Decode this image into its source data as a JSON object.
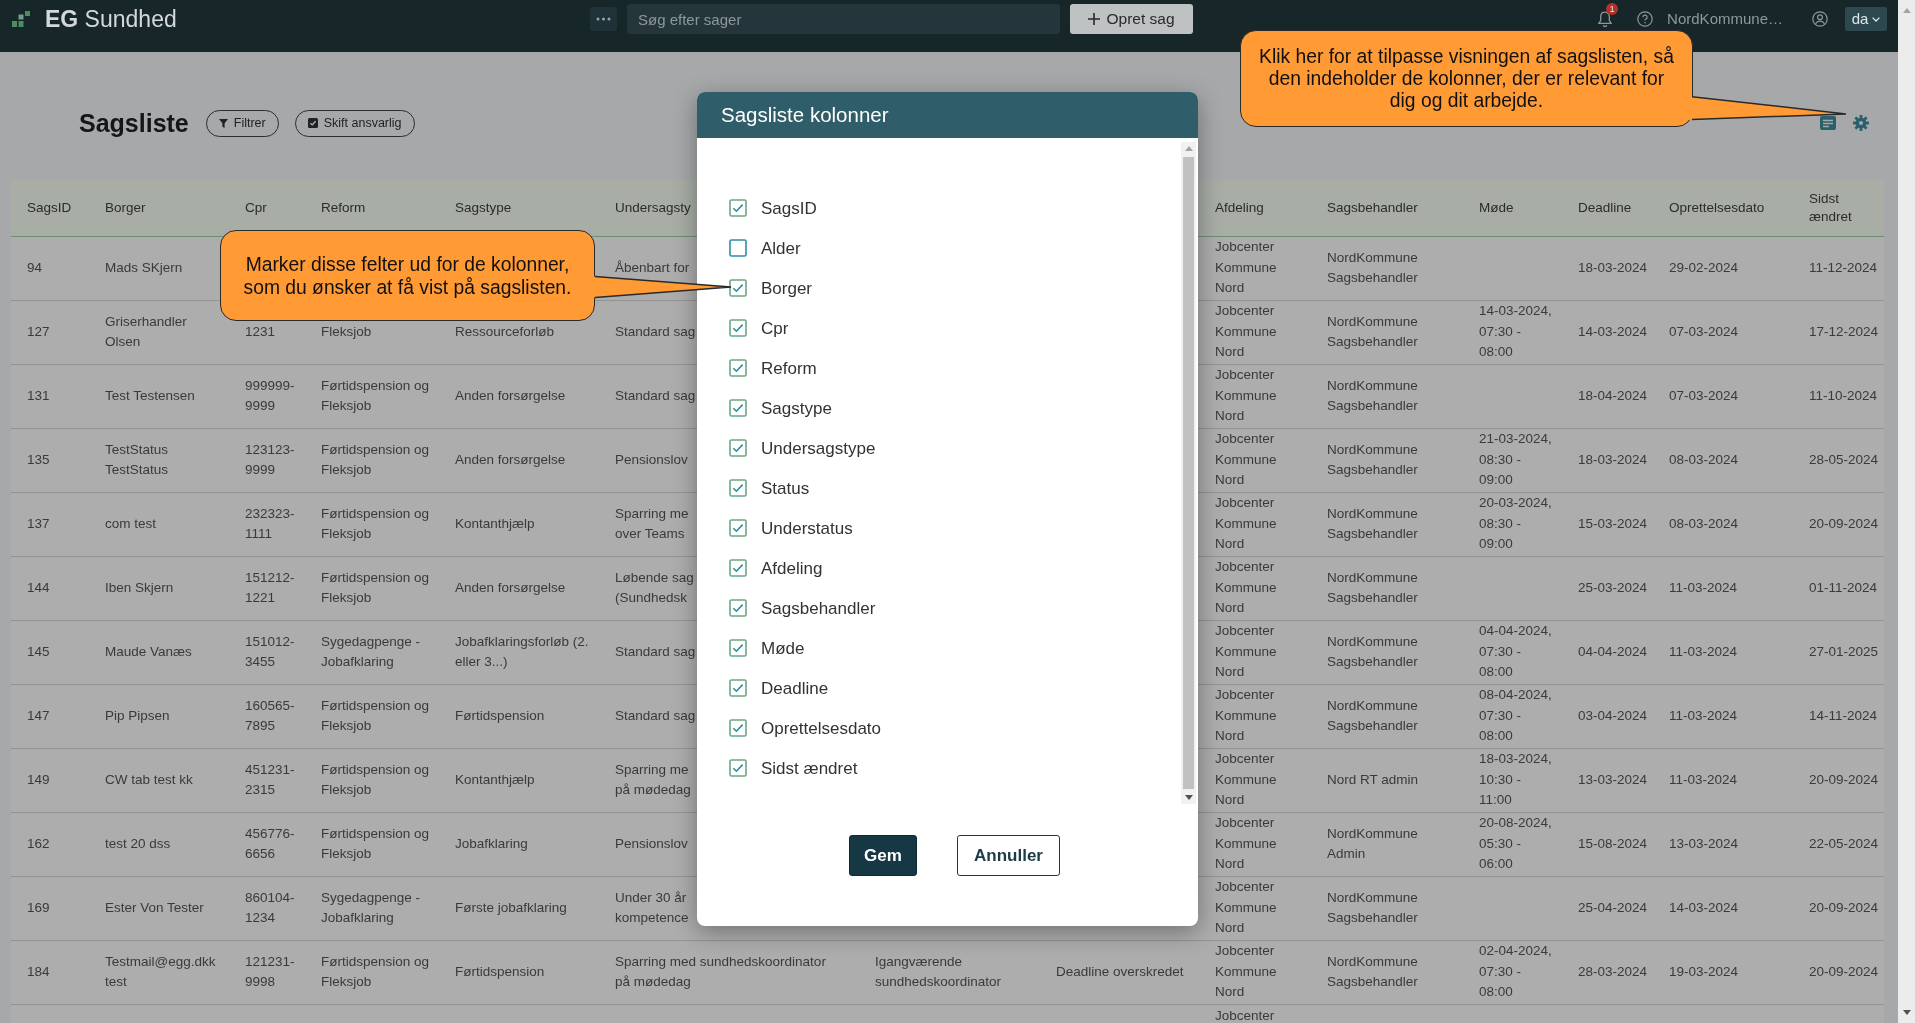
{
  "navbar": {
    "logo_text": "**EG** Sundhed",
    "search": {
      "placeholder": "Søg efter sager"
    },
    "create_button": "Opret sag",
    "notifications": {
      "count": "1"
    },
    "user_name": "NordKommune…",
    "language": "da"
  },
  "page": {
    "title": "Sagsliste",
    "filter_button": "Filtrer",
    "reassign_button": "Skift ansvarlig"
  },
  "table": {
    "columns": [
      "SagsID",
      "Borger",
      "Cpr",
      "Reform",
      "Sagstype",
      "Undersagsty",
      null,
      null,
      "Afdeling",
      "Sagsbehandler",
      "Møde",
      "Deadline",
      "Oprettelsesdato",
      "Sidst ændret"
    ],
    "rows": [
      [
        "94",
        "Mads SKjern",
        null,
        null,
        null,
        "Åbenbart for",
        null,
        null,
        "Jobcenter Kommune Nord",
        "NordKommune Sagsbehandler",
        null,
        "18-03-2024",
        "29-02-2024",
        "11-12-2024"
      ],
      [
        "127",
        "Griserhandler Olsen",
        "1231",
        "Fleksjob",
        "Ressourceforløb",
        "Standard sag",
        null,
        null,
        "Jobcenter Kommune Nord",
        "NordKommune Sagsbehandler",
        "14-03-2024, 07:30 - 08:00",
        "14-03-2024",
        "07-03-2024",
        "17-12-2024"
      ],
      [
        "131",
        "Test Testensen",
        "999999-9999",
        "Førtidspension og Fleksjob",
        "Anden forsørgelse",
        "Standard sag",
        null,
        null,
        "Jobcenter Kommune Nord",
        "NordKommune Sagsbehandler",
        null,
        "18-04-2024",
        "07-03-2024",
        "11-10-2024"
      ],
      [
        "135",
        "TestStatus TestStatus",
        "123123-9999",
        "Førtidspension og Fleksjob",
        "Anden forsørgelse",
        "Pensionslov",
        null,
        null,
        "Jobcenter Kommune Nord",
        "NordKommune Sagsbehandler",
        "21-03-2024, 08:30 - 09:00",
        "18-03-2024",
        "08-03-2024",
        "28-05-2024"
      ],
      [
        "137",
        "com test",
        "232323-1111",
        "Førtidspension og Fleksjob",
        "Kontanthjælp",
        "Sparring me\nover Teams",
        null,
        null,
        "Jobcenter Kommune Nord",
        "NordKommune Sagsbehandler",
        "20-03-2024, 08:30 - 09:00",
        "15-03-2024",
        "08-03-2024",
        "20-09-2024"
      ],
      [
        "144",
        "Iben Skjern",
        "151212-1221",
        "Førtidspension og Fleksjob",
        "Anden forsørgelse",
        "Løbende sag\n(Sundhedsk",
        null,
        null,
        "Jobcenter Kommune Nord",
        "NordKommune Sagsbehandler",
        null,
        "25-03-2024",
        "11-03-2024",
        "01-11-2024"
      ],
      [
        "145",
        "Maude Vanæs",
        "151012-3455",
        "Sygedagpenge - Jobafklaring",
        "Jobafklaringsforløb (2. eller 3...)",
        "Standard sag",
        null,
        null,
        "Jobcenter Kommune Nord",
        "NordKommune Sagsbehandler",
        "04-04-2024, 07:30 - 08:00",
        "04-04-2024",
        "11-03-2024",
        "27-01-2025"
      ],
      [
        "147",
        "Pip Pipsen",
        "160565-7895",
        "Førtidspension og Fleksjob",
        "Førtidspension",
        "Standard sag",
        null,
        null,
        "Jobcenter Kommune Nord",
        "NordKommune Sagsbehandler",
        "08-04-2024, 07:30 - 08:00",
        "03-04-2024",
        "11-03-2024",
        "14-11-2024"
      ],
      [
        "149",
        "CW tab test kk",
        "451231-2315",
        "Førtidspension og Fleksjob",
        "Kontanthjælp",
        "Sparring me\npå mødedag",
        null,
        null,
        "Jobcenter Kommune Nord",
        "Nord RT admin",
        "18-03-2024, 10:30 - 11:00",
        "13-03-2024",
        "11-03-2024",
        "20-09-2024"
      ],
      [
        "162",
        "test 20 dss",
        "456776-6656",
        "Førtidspension og Fleksjob",
        "Jobafklaring",
        "Pensionslov",
        null,
        null,
        "Jobcenter Kommune Nord",
        "NordKommune Admin",
        "20-08-2024, 05:30 - 06:00",
        "15-08-2024",
        "13-03-2024",
        "22-05-2024"
      ],
      [
        "169",
        "Ester Von Tester",
        "860104-1234",
        "Sygedagpenge - Jobafklaring",
        "Første jobafklaring",
        "Under 30 år\nkompetence",
        null,
        null,
        "Jobcenter Kommune Nord",
        "NordKommune Sagsbehandler",
        null,
        "25-04-2024",
        "14-03-2024",
        "20-09-2024"
      ],
      [
        "184",
        "Testmail@egg.dkk test",
        "121231-9998",
        "Førtidspension og Fleksjob",
        "Førtidspension",
        "Sparring med sundhedskoordinator på mødedag",
        "Igangværende sundhedskoordinator",
        "Deadline overskredet",
        "Jobcenter Kommune Nord",
        "NordKommune Sagsbehandler",
        "02-04-2024, 07:30 - 08:00",
        "28-03-2024",
        "19-03-2024",
        "20-09-2024"
      ],
      [
        null,
        null,
        null,
        null,
        null,
        null,
        null,
        null,
        "Jobcenter",
        null,
        null,
        null,
        null,
        null
      ]
    ]
  },
  "column_dialog": {
    "title": "Sagsliste kolonner",
    "options": [
      {
        "label": "SagsID",
        "checked": true
      },
      {
        "label": "Alder",
        "checked": false
      },
      {
        "label": "Borger",
        "checked": true
      },
      {
        "label": "Cpr",
        "checked": true
      },
      {
        "label": "Reform",
        "checked": true
      },
      {
        "label": "Sagstype",
        "checked": true
      },
      {
        "label": "Undersagstype",
        "checked": true
      },
      {
        "label": "Status",
        "checked": true
      },
      {
        "label": "Understatus",
        "checked": true
      },
      {
        "label": "Afdeling",
        "checked": true
      },
      {
        "label": "Sagsbehandler",
        "checked": true
      },
      {
        "label": "Møde",
        "checked": true
      },
      {
        "label": "Deadline",
        "checked": true
      },
      {
        "label": "Oprettelsesdato",
        "checked": true
      },
      {
        "label": "Sidst ændret",
        "checked": true
      }
    ],
    "save_button": "Gem",
    "cancel_button": "Annuller"
  },
  "callouts": [
    {
      "text": "Klik her for at tilpasse visningen af sagslisten, så den indeholder de kolonner, der er relevant for dig og dit arbejde."
    },
    {
      "text": "Marker disse felter ud for de kolonner, som du ønsker at få vist på sagslisten."
    }
  ]
}
